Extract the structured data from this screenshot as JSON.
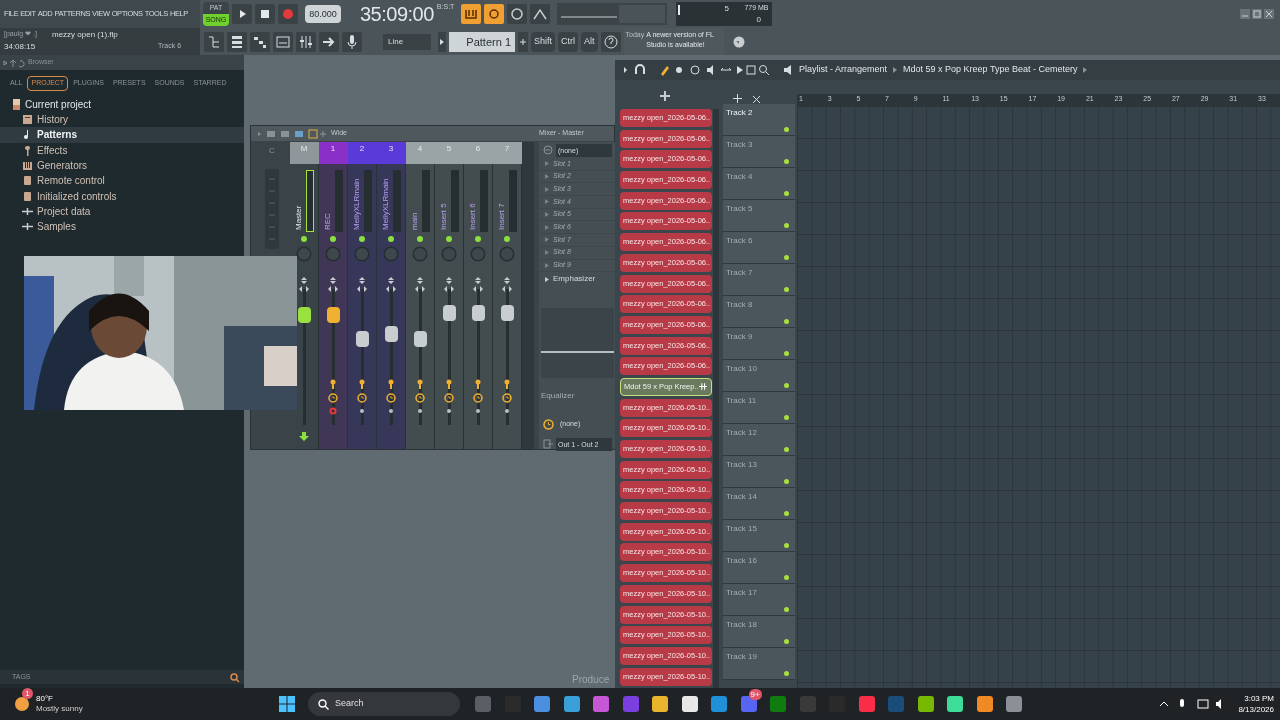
{
  "menu": [
    "FILE",
    "EDIT",
    "ADD",
    "PATTERNS",
    "VIEW",
    "OPTIONS",
    "TOOLS",
    "HELP"
  ],
  "transport": {
    "pat_label": "PAT",
    "song_label": "SONG",
    "song_mode": true,
    "tempo": "80.000",
    "time": "35:09:00",
    "time_label": "B:S:T"
  },
  "cpu": {
    "voices": "5",
    "memory": "779 MB",
    "count": "0"
  },
  "project": {
    "user": "[paulg ❤ .]",
    "file": "mezzy open (1).flp",
    "elapsed": "34:08:15",
    "track": "Track 6"
  },
  "toolbar": {
    "input": "Line",
    "pattern": "Pattern 1",
    "keys": [
      "Shift",
      "Ctrl",
      "Alt"
    ],
    "notice_when": "Today",
    "notice": "A newer version of FL Studio is available!"
  },
  "browser": {
    "title": "Browser",
    "tabs": [
      {
        "label": "ALL",
        "selected": false
      },
      {
        "label": "PROJECT",
        "selected": true
      },
      {
        "label": "PLUGINS",
        "selected": false
      },
      {
        "label": "PRESETS",
        "selected": false
      },
      {
        "label": "SOUNDS",
        "selected": false
      },
      {
        "label": "STARRED",
        "selected": false
      }
    ],
    "root": "Current project",
    "items": [
      {
        "label": "History",
        "kind": "history",
        "selected": false
      },
      {
        "label": "Patterns",
        "kind": "note",
        "selected": true
      },
      {
        "label": "Effects",
        "kind": "plug",
        "selected": false
      },
      {
        "label": "Generators",
        "kind": "keys",
        "selected": false
      },
      {
        "label": "Remote control",
        "kind": "device",
        "selected": false
      },
      {
        "label": "Initialized controls",
        "kind": "device",
        "selected": false
      },
      {
        "label": "Project data",
        "kind": "plus",
        "selected": false
      },
      {
        "label": "Samples",
        "kind": "plus",
        "selected": false
      }
    ],
    "tags": "TAGS"
  },
  "mixer": {
    "title": "Mixer - Master",
    "mode": "Wide",
    "current": "C",
    "strips": [
      {
        "number": "M",
        "name": "Master",
        "kind": "master",
        "level": 0.85,
        "color": "#8f979a"
      },
      {
        "number": "1",
        "name": "REC",
        "kind": "insert",
        "armed": true,
        "level": 0.85,
        "color": "#8a2fc8"
      },
      {
        "number": "2",
        "name": "MellyXLRmain",
        "kind": "insert",
        "armed": false,
        "level": 0.65,
        "color": "#5a3ad8"
      },
      {
        "number": "3",
        "name": "MellyXLRmain",
        "kind": "insert",
        "armed": false,
        "level": 0.69,
        "color": "#5a3ad8"
      },
      {
        "number": "4",
        "name": "main",
        "kind": "insert",
        "armed": false,
        "level": 0.65,
        "color": "#9aa3a6"
      },
      {
        "number": "5",
        "name": "Insert 5",
        "kind": "insert",
        "armed": false,
        "level": 0.87,
        "color": "#9aa3a6"
      },
      {
        "number": "6",
        "name": "Insert 6",
        "kind": "insert",
        "armed": false,
        "level": 0.87,
        "color": "#9aa3a6"
      },
      {
        "number": "7",
        "name": "Insert 7",
        "kind": "insert",
        "armed": false,
        "level": 0.87,
        "color": "#9aa3a6"
      }
    ],
    "input": "(none)",
    "slots": [
      "Slot 1",
      "Slot 2",
      "Slot 3",
      "Slot 4",
      "Slot 5",
      "Slot 6",
      "Slot 7",
      "Slot 8",
      "Slot 9"
    ],
    "effect": "Emphasizer",
    "eq_label": "Equalizer",
    "sidechain": "(none)",
    "output": "Out 1 - Out 2"
  },
  "background_text": "Produce",
  "playlist": {
    "title": "Playlist - Arrangement",
    "song": "Mdot 59 x Pop Kreep Type Beat - Cemetery",
    "patterns": [
      {
        "label": "mezzy open_2026-05-06..",
        "selected": false
      },
      {
        "label": "mezzy open_2026-05-06..",
        "selected": false
      },
      {
        "label": "mezzy open_2026-05-06..",
        "selected": false
      },
      {
        "label": "mezzy open_2026-05-06..",
        "selected": false
      },
      {
        "label": "mezzy open_2026-05-06..",
        "selected": false
      },
      {
        "label": "mezzy open_2026-05-06..",
        "selected": false
      },
      {
        "label": "mezzy open_2026-05-06..",
        "selected": false
      },
      {
        "label": "mezzy open_2026-05-06..",
        "selected": false
      },
      {
        "label": "mezzy open_2026-05-06..",
        "selected": false
      },
      {
        "label": "mezzy open_2026-05-06..",
        "selected": false
      },
      {
        "label": "mezzy open_2026-05-06..",
        "selected": false
      },
      {
        "label": "mezzy open_2026-05-06..",
        "selected": false
      },
      {
        "label": "mezzy open_2026-05-06..",
        "selected": false
      },
      {
        "label": "Mdot 59 x Pop Kreep..",
        "selected": true
      },
      {
        "label": "mezzy open_2026-05-10..",
        "selected": false
      },
      {
        "label": "mezzy open_2026-05-10..",
        "selected": false
      },
      {
        "label": "mezzy open_2026-05-10..",
        "selected": false
      },
      {
        "label": "mezzy open_2026-05-10..",
        "selected": false
      },
      {
        "label": "mezzy open_2026-05-10..",
        "selected": false
      },
      {
        "label": "mezzy open_2026-05-10..",
        "selected": false
      },
      {
        "label": "mezzy open_2026-05-10..",
        "selected": false
      },
      {
        "label": "mezzy open_2026-05-10..",
        "selected": false
      },
      {
        "label": "mezzy open_2026-05-10..",
        "selected": false
      },
      {
        "label": "mezzy open_2026-05-10..",
        "selected": false
      },
      {
        "label": "mezzy open_2026-05-10..",
        "selected": false
      },
      {
        "label": "mezzy open_2026-05-10..",
        "selected": false
      },
      {
        "label": "mezzy open_2026-05-10..",
        "selected": false
      },
      {
        "label": "mezzy open_2026-05-10..",
        "selected": false
      }
    ],
    "tracks": [
      {
        "label": "Track 2",
        "selected": true
      },
      {
        "label": "Track 3",
        "selected": false
      },
      {
        "label": "Track 4",
        "selected": false
      },
      {
        "label": "Track 5",
        "selected": false
      },
      {
        "label": "Track 6",
        "selected": false
      },
      {
        "label": "Track 7",
        "selected": false
      },
      {
        "label": "Track 8",
        "selected": false
      },
      {
        "label": "Track 9",
        "selected": false
      },
      {
        "label": "Track 10",
        "selected": false
      },
      {
        "label": "Track 11",
        "selected": false
      },
      {
        "label": "Track 12",
        "selected": false
      },
      {
        "label": "Track 13",
        "selected": false
      },
      {
        "label": "Track 14",
        "selected": false
      },
      {
        "label": "Track 15",
        "selected": false
      },
      {
        "label": "Track 16",
        "selected": false
      },
      {
        "label": "Track 17",
        "selected": false
      },
      {
        "label": "Track 18",
        "selected": false
      },
      {
        "label": "Track 19",
        "selected": false
      }
    ],
    "ruler": [
      "1",
      "3",
      "5",
      "7",
      "9",
      "11",
      "13",
      "15",
      "17",
      "19",
      "21",
      "23",
      "25",
      "27",
      "29",
      "31",
      "33"
    ]
  },
  "taskbar": {
    "temperature": "80°F",
    "weather": "Mostly sunny",
    "weather_badge": "1",
    "search": "Search",
    "apps": [
      {
        "color": "#5a5f66"
      },
      {
        "color": "#2b2b2b"
      },
      {
        "color": "#4a8fe0"
      },
      {
        "color": "#3aa0d8"
      },
      {
        "color": "#c658d8"
      },
      {
        "color": "#7b3fe0"
      },
      {
        "color": "#e8b42c"
      },
      {
        "color": "#e8e8e8"
      },
      {
        "color": "#1f8fd8"
      },
      {
        "color": "#5865f2"
      },
      {
        "color": "#107c10"
      },
      {
        "color": "#3a3a3a"
      },
      {
        "color": "#2a2a2a"
      },
      {
        "color": "#fa2d48"
      },
      {
        "color": "#1b4d7a"
      },
      {
        "color": "#76b900"
      },
      {
        "color": "#3ddc97"
      },
      {
        "color": "#f08a24"
      },
      {
        "color": "#8a9096"
      }
    ],
    "app_badge": "9+",
    "time": "3:03 PM",
    "date": "8/13/2026"
  }
}
